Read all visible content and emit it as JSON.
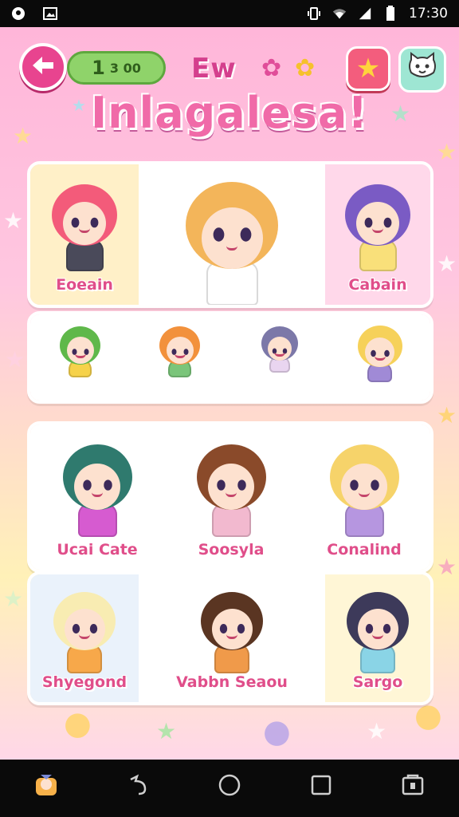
{
  "status_bar": {
    "time": "17:30",
    "left_icons": [
      "location-icon",
      "image-icon"
    ],
    "right_icons": [
      "vibrate-icon",
      "wifi-icon",
      "signal-icon",
      "battery-icon"
    ]
  },
  "header": {
    "coin_value": "1",
    "coin_extra": "3 00",
    "mini_title": "Ew",
    "title": "Inlagalesa!"
  },
  "panels": [
    {
      "id": "panel-1",
      "characters": [
        {
          "label": "Eoeain",
          "hair": "#f35b7a",
          "dress": "#4a4a5a",
          "bg": "#fff0c8"
        },
        {
          "label": "",
          "hair": "#f3b55a",
          "dress": "#ffffff",
          "bg": "#ffffff"
        },
        {
          "label": "Cabain",
          "hair": "#7a5bc4",
          "dress": "#f9e07a",
          "bg": "#ffd8ea"
        }
      ]
    },
    {
      "id": "panel-2",
      "characters": [
        {
          "label": "",
          "hair": "#5fb84a",
          "dress": "#f6d24a",
          "bg": "#ffffff"
        },
        {
          "label": "",
          "hair": "#f2913c",
          "dress": "#7ac57a",
          "bg": "#ffffff"
        },
        {
          "label": "",
          "hair": "#7c78a8",
          "dress": "#e9d5f0",
          "bg": "#ffffff"
        },
        {
          "label": "",
          "hair": "#f6d15a",
          "dress": "#a08ad6",
          "bg": "#ffffff"
        }
      ]
    },
    {
      "id": "panel-3",
      "characters": [
        {
          "label": "Ucai Cate",
          "hair": "#2f7a6e",
          "dress": "#d65bd0",
          "bg": "#ffffff"
        },
        {
          "label": "Soosyla",
          "hair": "#8a4a2a",
          "dress": "#f2b9cf",
          "bg": "#ffffff"
        },
        {
          "label": "Conalind",
          "hair": "#f6d36a",
          "dress": "#b696e0",
          "bg": "#ffffff"
        }
      ]
    },
    {
      "id": "panel-4",
      "characters": [
        {
          "label": "Shyegond",
          "hair": "#f8ecb2",
          "dress": "#f7a84a",
          "bg": "#eaf2fb"
        },
        {
          "label": "Vabbn Seaou",
          "hair": "#5a3522",
          "dress": "#f09a4a",
          "bg": "#ffffff"
        },
        {
          "label": "Sargo",
          "hair": "#3d3a5a",
          "dress": "#8ad4e6",
          "bg": "#fff6d6"
        }
      ]
    }
  ],
  "nav": {
    "buttons": [
      "home-app-icon",
      "back-icon",
      "home-icon",
      "recents-icon",
      "screenshot-icon"
    ]
  },
  "colors": {
    "accent_pink": "#e8448f",
    "coin_green": "#8fd36a",
    "title_pink": "#f06aa8"
  }
}
